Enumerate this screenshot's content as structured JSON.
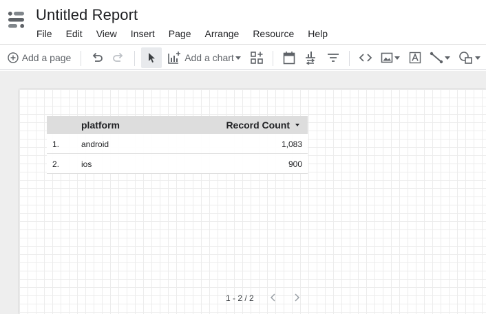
{
  "app": {
    "title": "Untitled Report",
    "menu": [
      "File",
      "Edit",
      "View",
      "Insert",
      "Page",
      "Arrange",
      "Resource",
      "Help"
    ]
  },
  "toolbar": {
    "add_page_label": "Add a page",
    "add_chart_label": "Add a chart",
    "icons": [
      "add-page-icon",
      "undo-icon",
      "redo-icon",
      "select-cursor-icon",
      "add-chart-icon",
      "community-viz-icon",
      "date-range-icon",
      "data-control-icon",
      "filter-control-icon",
      "embed-url-icon",
      "image-icon",
      "text-icon",
      "line-icon",
      "shape-icon"
    ]
  },
  "table": {
    "columns": {
      "index": "",
      "platform": "platform",
      "count": "Record Count"
    },
    "rows": [
      {
        "index": "1.",
        "platform": "android",
        "count": "1,083"
      },
      {
        "index": "2.",
        "platform": "ios",
        "count": "900"
      }
    ],
    "pagination": "1 - 2 / 2"
  },
  "colors": {
    "header_bg": "#dddddd",
    "workspace_bg": "#eeeeee",
    "icon": "#5f6368"
  }
}
